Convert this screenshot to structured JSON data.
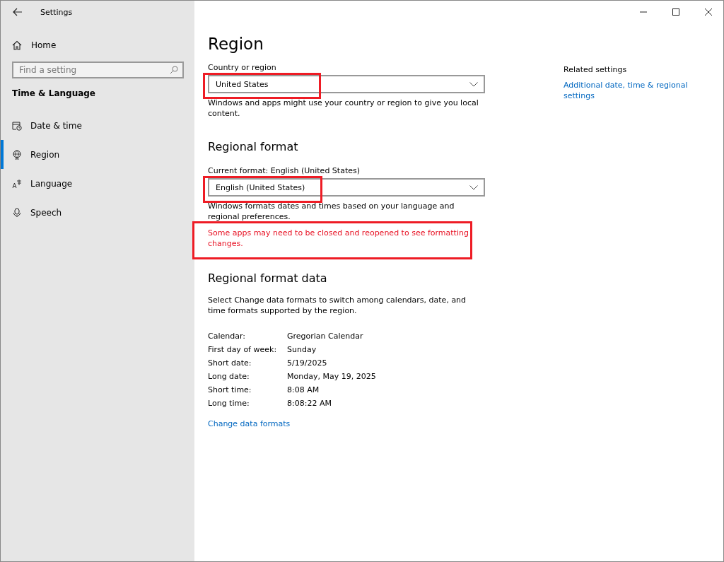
{
  "window": {
    "title": "Settings"
  },
  "sidebar": {
    "home": "Home",
    "search": {
      "placeholder": "Find a setting"
    },
    "section": "Time & Language",
    "items": [
      {
        "label": "Date & time",
        "kind": "calendar",
        "selected": false
      },
      {
        "label": "Region",
        "kind": "globe",
        "selected": true
      },
      {
        "label": "Language",
        "kind": "language",
        "selected": false
      },
      {
        "label": "Speech",
        "kind": "microphone",
        "selected": false
      }
    ]
  },
  "page": {
    "title": "Region",
    "country": {
      "label": "Country or region",
      "value": "United States",
      "highlighted": true,
      "description": "Windows and apps might use your country or region to give you local content."
    },
    "format": {
      "heading": "Regional format",
      "label": "Current format: English (United States)",
      "value": "English (United States)",
      "highlighted": true,
      "description": "Windows formats dates and times based on your language and regional preferences.",
      "warning": "Some apps may need to be closed and reopened to see formatting changes.",
      "warning_highlighted": true
    },
    "format_data": {
      "heading": "Regional format data",
      "description": "Select Change data formats to switch among calendars, date, and time formats supported by the region.",
      "rows": [
        {
          "label": "Calendar:",
          "value": "Gregorian Calendar"
        },
        {
          "label": "First day of week:",
          "value": "Sunday"
        },
        {
          "label": "Short date:",
          "value": "5/19/2025"
        },
        {
          "label": "Long date:",
          "value": "Monday, May 19, 2025"
        },
        {
          "label": "Short time:",
          "value": "8:08 AM"
        },
        {
          "label": "Long time:",
          "value": "8:08:22 AM"
        }
      ],
      "link": "Change data formats"
    }
  },
  "related": {
    "heading": "Related settings",
    "link": "Additional date, time & regional settings"
  }
}
